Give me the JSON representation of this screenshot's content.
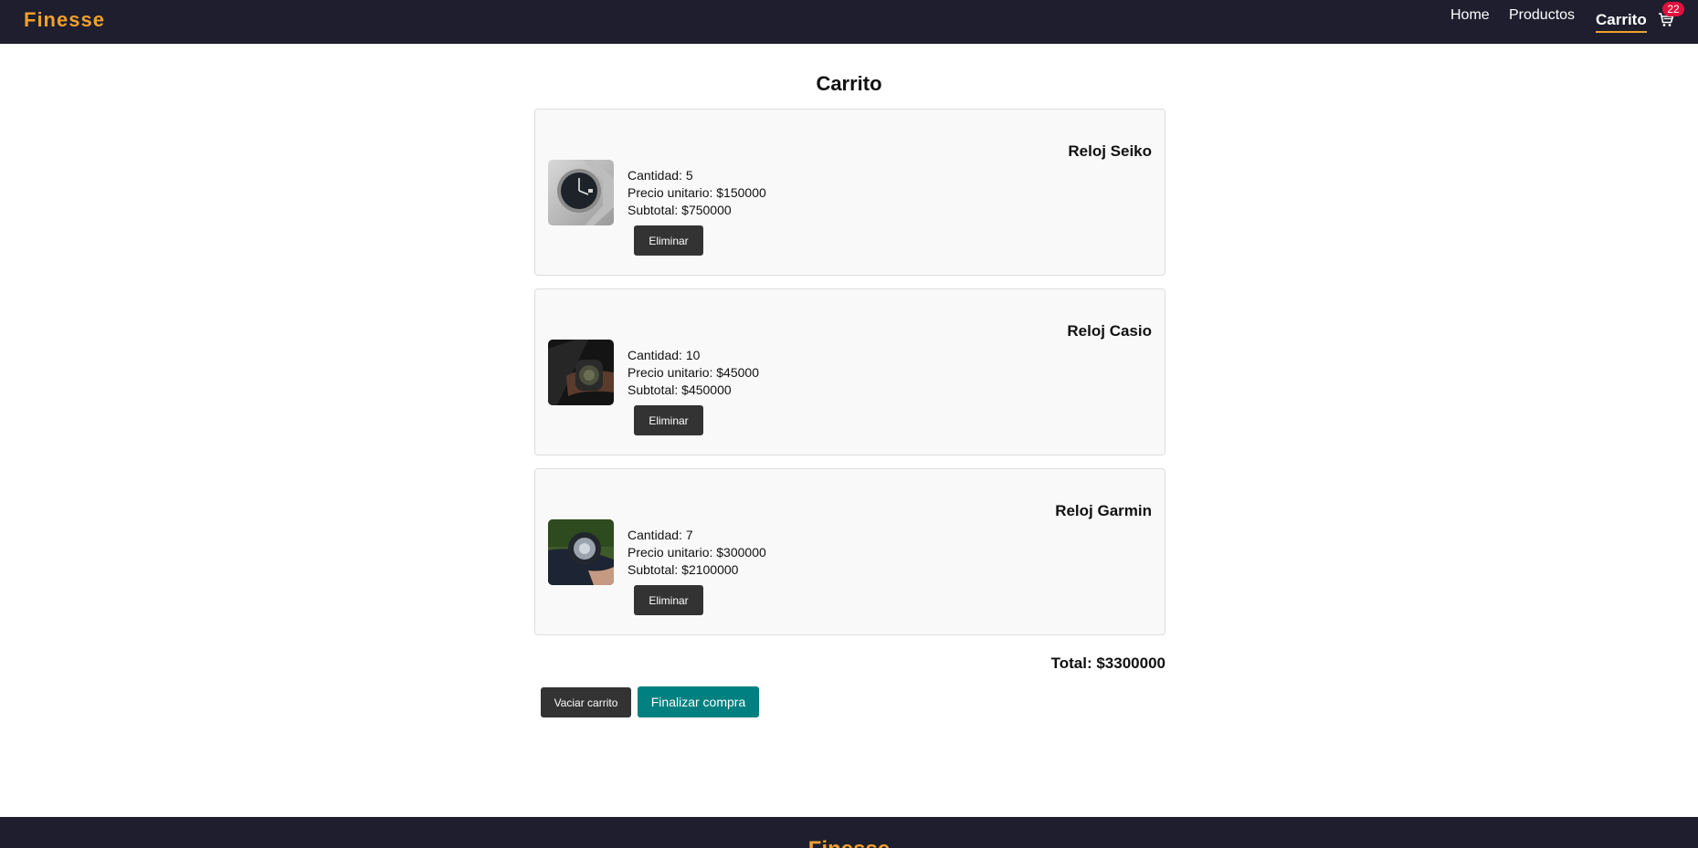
{
  "navbar": {
    "brand": "Finesse",
    "links": [
      {
        "label": "Home"
      },
      {
        "label": "Productos"
      },
      {
        "label": "Carrito",
        "active": true
      }
    ],
    "cart_icon": "cart-icon",
    "cart_count": "22"
  },
  "page": {
    "title": "Carrito"
  },
  "cart": {
    "items": [
      {
        "name": "Reloj Seiko",
        "quantity": "Cantidad: 5",
        "unit_price": "Precio unitario: $150000",
        "subtotal": "Subtotal: $750000",
        "remove_label": "Eliminar"
      },
      {
        "name": "Reloj Casio",
        "quantity": "Cantidad: 10",
        "unit_price": "Precio unitario: $45000",
        "subtotal": "Subtotal: $450000",
        "remove_label": "Eliminar"
      },
      {
        "name": "Reloj Garmin",
        "quantity": "Cantidad: 7",
        "unit_price": "Precio unitario: $300000",
        "subtotal": "Subtotal: $2100000",
        "remove_label": "Eliminar"
      }
    ],
    "total": "Total: $3300000",
    "clear_label": "Vaciar carrito",
    "checkout_label": "Finalizar compra"
  },
  "footer": {
    "brand": "Finesse"
  },
  "colors": {
    "nav_bg": "#1e1e2f",
    "brand": "#f0a02c",
    "badge": "#e0113c",
    "checkout": "#008080",
    "dark_button": "#333333"
  }
}
